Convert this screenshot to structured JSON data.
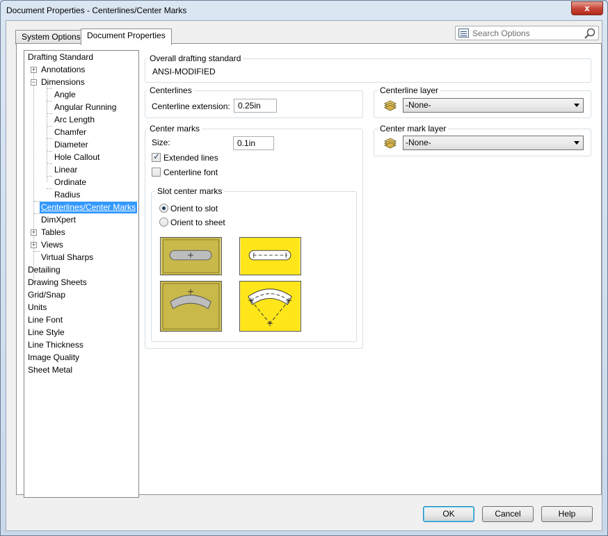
{
  "window": {
    "title": "Document Properties - Centerlines/Center Marks",
    "close_label": "x"
  },
  "tabs": [
    {
      "label": "System Options"
    },
    {
      "label": "Document Properties"
    }
  ],
  "search": {
    "placeholder": "Search Options"
  },
  "tree": {
    "items": [
      {
        "label": "Drafting Standard"
      },
      {
        "label": "Annotations"
      },
      {
        "label": "Dimensions"
      },
      {
        "label": "Angle"
      },
      {
        "label": "Angular Running"
      },
      {
        "label": "Arc Length"
      },
      {
        "label": "Chamfer"
      },
      {
        "label": "Diameter"
      },
      {
        "label": "Hole Callout"
      },
      {
        "label": "Linear"
      },
      {
        "label": "Ordinate"
      },
      {
        "label": "Radius"
      },
      {
        "label": "Centerlines/Center Marks"
      },
      {
        "label": "DimXpert"
      },
      {
        "label": "Tables"
      },
      {
        "label": "Views"
      },
      {
        "label": "Virtual Sharps"
      },
      {
        "label": "Detailing"
      },
      {
        "label": "Drawing Sheets"
      },
      {
        "label": "Grid/Snap"
      },
      {
        "label": "Units"
      },
      {
        "label": "Line Font"
      },
      {
        "label": "Line Style"
      },
      {
        "label": "Line Thickness"
      },
      {
        "label": "Image Quality"
      },
      {
        "label": "Sheet Metal"
      }
    ],
    "expanders": {
      "collapsed": "+",
      "expanded": "−"
    }
  },
  "overall": {
    "title": "Overall drafting standard",
    "value": "ANSI-MODIFIED"
  },
  "centerlines": {
    "title": "Centerlines",
    "extension_label": "Centerline extension:",
    "extension_value": "0.25in"
  },
  "center_marks": {
    "title": "Center marks",
    "size_label": "Size:",
    "size_value": "0.1in",
    "extended_lines_label": "Extended lines",
    "extended_lines_checked": true,
    "centerline_font_label": "Centerline font",
    "centerline_font_checked": false
  },
  "slot_center_marks": {
    "title": "Slot center marks",
    "orient_to_slot_label": "Orient to slot",
    "orient_to_sheet_label": "Orient to sheet",
    "selected": "orient_to_slot",
    "thumbnails": [
      "slot-straight-center-icon",
      "slot-straight-ends-icon",
      "slot-arc-center-icon",
      "slot-arc-ends-icon"
    ]
  },
  "centerline_layer": {
    "title": "Centerline layer",
    "value": "-None-"
  },
  "center_mark_layer": {
    "title": "Center mark layer",
    "value": "-None-"
  },
  "buttons": {
    "ok": "OK",
    "cancel": "Cancel",
    "help": "Help"
  },
  "colors": {
    "selection": "#3399ff",
    "slot_selected_bg": "#ffe61a",
    "slot_unselected_bg": "#c8b84a"
  }
}
